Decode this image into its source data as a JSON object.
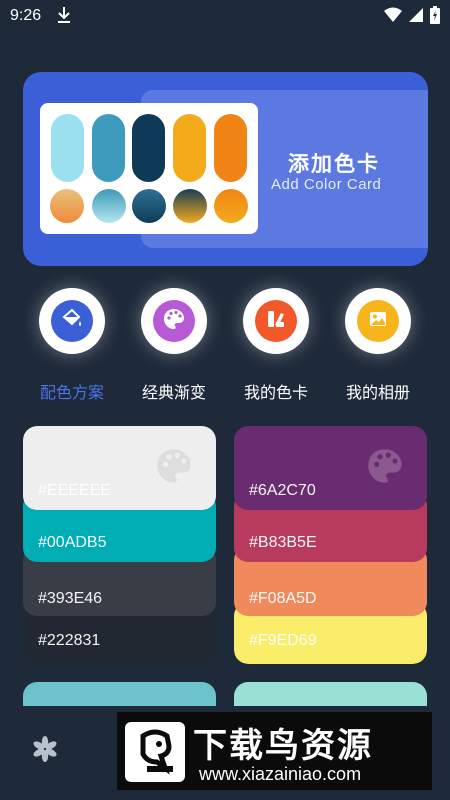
{
  "status_bar": {
    "time": "9:26"
  },
  "hero": {
    "title": "添加色卡",
    "subtitle": "Add Color Card",
    "pill_colors": [
      "#9ae0ef",
      "#3d9bbd",
      "#0f3a57",
      "#f3ab1c",
      "#f08414"
    ],
    "dot_gradients": [
      [
        "#f08a3c",
        "#e7c27a"
      ],
      [
        "#b5e6f2",
        "#3f9ab7"
      ],
      [
        "#0f3a57",
        "#2e7196"
      ],
      [
        "#f3ab1c",
        "#183d55"
      ],
      [
        "#f3ab1c",
        "#f08414"
      ]
    ]
  },
  "menu": [
    {
      "label": "配色方案",
      "icon": "paint-bucket-icon",
      "icon_bg": "#3b5fd6",
      "active": true
    },
    {
      "label": "经典渐变",
      "icon": "palette-icon",
      "icon_bg": "#b65ad6",
      "active": false
    },
    {
      "label": "我的色卡",
      "icon": "color-card-icon",
      "icon_bg": "#f2582a",
      "active": false
    },
    {
      "label": "我的相册",
      "icon": "photo-album-icon",
      "icon_bg": "#f7b51b",
      "active": false
    }
  ],
  "palettes": [
    {
      "colors": [
        {
          "hex": "#EEEEEE",
          "label": "#EEEEEE"
        },
        {
          "hex": "#00ADB5",
          "label": "#00ADB5"
        },
        {
          "hex": "#393E46",
          "label": "#393E46"
        },
        {
          "hex": "#222831",
          "label": "#222831"
        }
      ]
    },
    {
      "colors": [
        {
          "hex": "#6A2C70",
          "label": "#6A2C70"
        },
        {
          "hex": "#B83B5E",
          "label": "#B83B5E"
        },
        {
          "hex": "#F08A5D",
          "label": "#F08A5D"
        },
        {
          "hex": "#F9ED69",
          "label": "#F9ED69"
        }
      ]
    }
  ],
  "bottom_cards": [
    "#6cc3cb",
    "#9ae0d4"
  ],
  "watermark": {
    "title": "下载鸟资源",
    "url": "www.xiazainiao.com"
  }
}
